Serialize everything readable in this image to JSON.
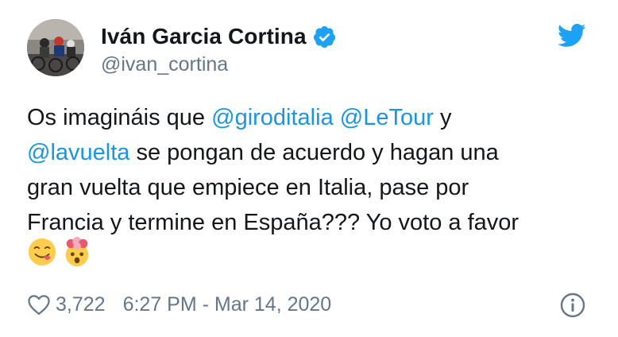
{
  "author": {
    "display_name": "Iván Garcia Cortina",
    "handle": "@ivan_cortina",
    "verified": true,
    "avatar_icon": "avatar-cyclists-photo"
  },
  "tweet": {
    "lines": [
      [
        {
          "text": "Os imagináis que ",
          "type": "text"
        },
        {
          "text": "@giroditalia",
          "type": "mention"
        },
        {
          "text": " ",
          "type": "text"
        },
        {
          "text": "@LeTour",
          "type": "mention"
        },
        {
          "text": " y",
          "type": "text"
        }
      ],
      [
        {
          "text": "@lavuelta",
          "type": "mention"
        },
        {
          "text": " se pongan de acuerdo y hagan una",
          "type": "text"
        }
      ],
      [
        {
          "text": "gran vuelta que empiece en Italia, pase por",
          "type": "text"
        }
      ],
      [
        {
          "text": "Francia y termine en España??? Yo voto a favor",
          "type": "text"
        }
      ]
    ],
    "emojis": [
      "yum-face-emoji",
      "exploding-head-emoji"
    ]
  },
  "footer": {
    "likes": "3,722",
    "timestamp": "6:27 PM - Mar 14, 2020"
  },
  "colors": {
    "mention": "#1b95e0",
    "secondary": "#657786",
    "brand": "#1da1f2"
  }
}
